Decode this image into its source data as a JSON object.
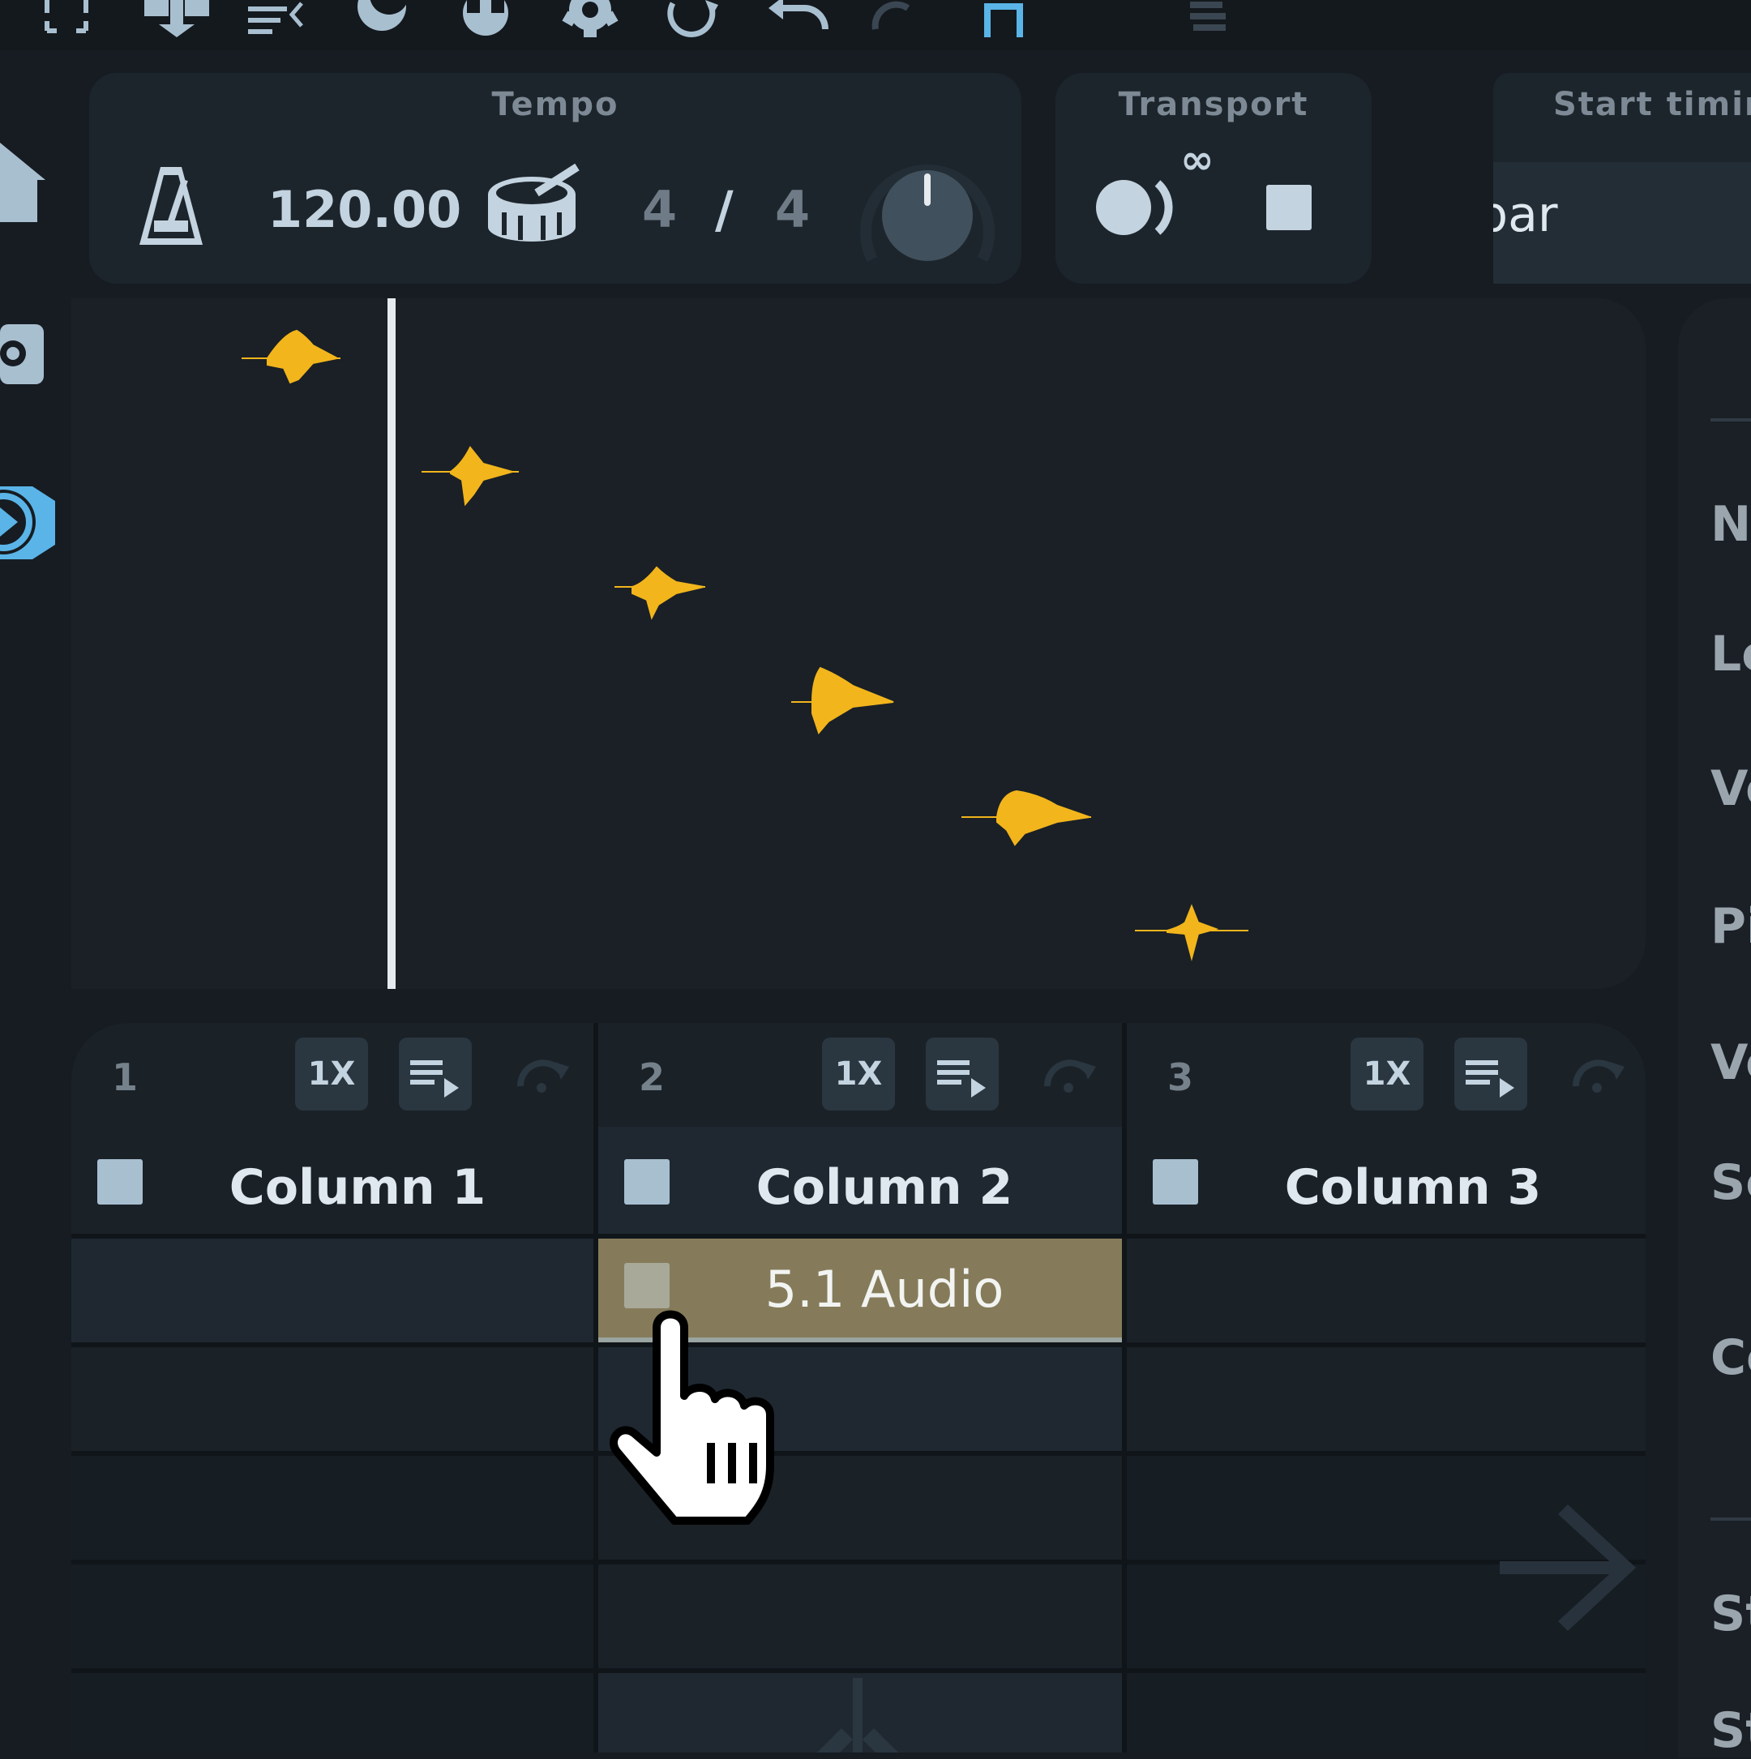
{
  "toolbar": {
    "icons": [
      "fullscreen-icon",
      "grid-icon",
      "list-icon",
      "moon-icon",
      "drop-icon",
      "gear-icon",
      "refresh-icon",
      "undo-icon",
      "redo-icon",
      "logo-n-icon",
      "logo-e-icon"
    ]
  },
  "tempo": {
    "title": "Tempo",
    "bpm": "120.00",
    "sig_num": "4",
    "sig_slash": "/",
    "sig_den": "4"
  },
  "transport": {
    "title": "Transport",
    "loop_symbol": "∞"
  },
  "start_timing": {
    "title": "Start timing",
    "value": "bar"
  },
  "columns": [
    {
      "number": "1",
      "rate": "1X",
      "name": "Column 1"
    },
    {
      "number": "2",
      "rate": "1X",
      "name": "Column 2"
    },
    {
      "number": "3",
      "rate": "1X",
      "name": "Column 3"
    }
  ],
  "clip": {
    "label": "5.1 Audio",
    "color": "#857b5a"
  },
  "right_panel": {
    "labels": [
      "Na",
      "Lo",
      "Vo",
      "Pi",
      "Vo",
      "Sc",
      "Co",
      "St",
      "St"
    ]
  },
  "colors": {
    "accent": "#a8bfd0",
    "waveform": "#f2b51c",
    "background": "#161c22"
  }
}
